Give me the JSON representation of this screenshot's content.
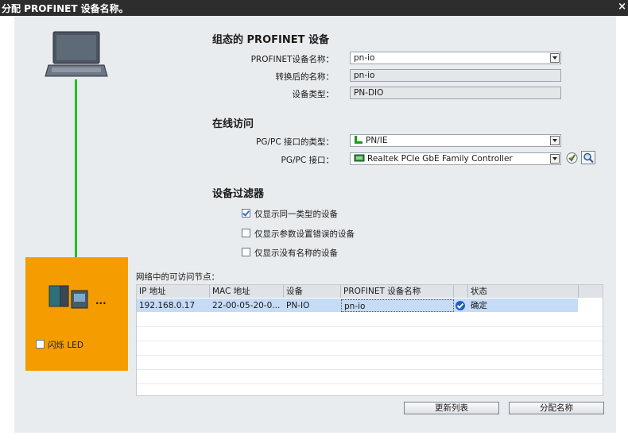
{
  "window": {
    "title": "分配 PROFINET 设备名称。",
    "close_glyph": "×"
  },
  "configured_device": {
    "heading": "组态的 PROFINET 设备",
    "name_label": "PROFINET设备名称：",
    "name_value": "pn-io",
    "converted_label": "转换后的名称：",
    "converted_value": "pn-io",
    "type_label": "设备类型：",
    "type_value": "PN-DIO"
  },
  "online_access": {
    "heading": "在线访问",
    "iface_type_label": "PG/PC 接口的类型：",
    "iface_type_value": "PN/IE",
    "iface_label": "PG/PC 接口：",
    "iface_value": "Realtek PCIe GbE Family Controller"
  },
  "device_filter": {
    "heading": "设备过滤器",
    "options": [
      {
        "label": "仅显示同一类型的设备",
        "checked": true
      },
      {
        "label": "仅显示参数设置错误的设备",
        "checked": false
      },
      {
        "label": "仅显示没有名称的设备",
        "checked": false
      }
    ]
  },
  "flash_led": {
    "label": "闪烁 LED",
    "checked": false,
    "more": "..."
  },
  "nodes": {
    "heading": "网络中的可访问节点：",
    "columns": [
      "IP 地址",
      "MAC 地址",
      "设备",
      "PROFINET 设备名称",
      "状态"
    ],
    "rows": [
      {
        "ip": "192.168.0.17",
        "mac": "22-00-05-20-0...",
        "device": "PN-IO",
        "name": "pn-io",
        "status": "确定"
      }
    ]
  },
  "buttons": {
    "refresh": "更新列表",
    "assign": "分配名称"
  },
  "colors": {
    "accent_orange": "#f59c00",
    "link_green": "#22c022",
    "selected_row": "#c6dbf5"
  }
}
